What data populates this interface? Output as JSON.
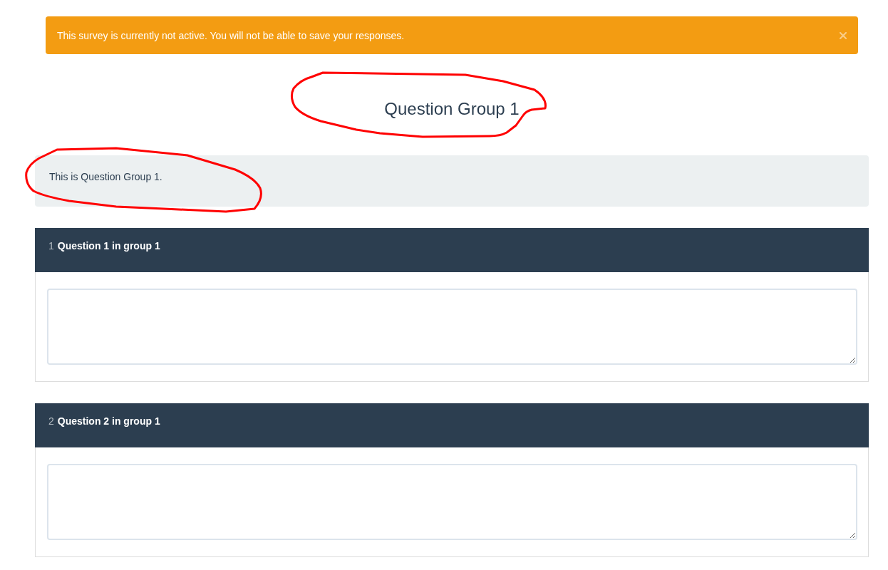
{
  "alert": {
    "message": "This survey is currently not active. You will not be able to save your responses.",
    "dismissible": true
  },
  "group": {
    "title": "Question Group 1",
    "title_circled": true,
    "description": "This is Question Group 1.",
    "description_circled": true
  },
  "questions": [
    {
      "number": "1",
      "text": "Question 1 in group 1"
    },
    {
      "number": "2",
      "text": "Question 2 in group 1"
    }
  ]
}
